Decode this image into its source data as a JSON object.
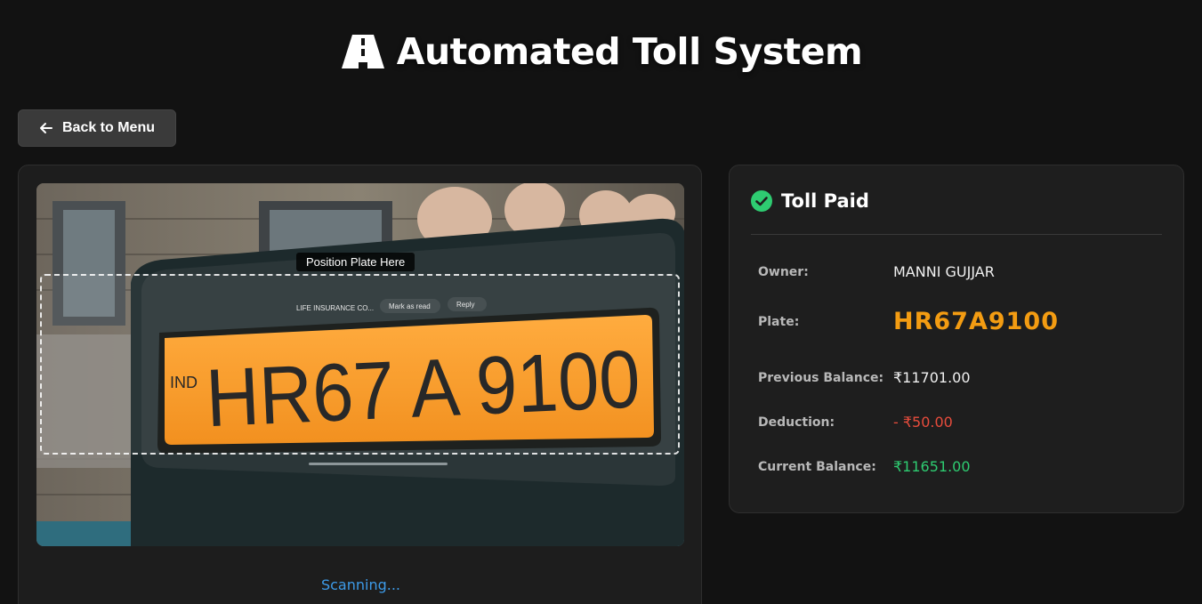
{
  "app": {
    "title": "Automated Toll System",
    "logo_icon": "road-icon"
  },
  "nav": {
    "back_label": "Back to Menu",
    "back_icon": "arrow-left-icon"
  },
  "scanner": {
    "overlay_label": "Position Plate Here",
    "status": "Scanning...",
    "camera_plate_text": "HR67 A 9100",
    "camera_plate_prefix": "IND",
    "camera_notification": {
      "text": "LIFE INSURANCE CO...",
      "action_1": "Mark as read",
      "action_2": "Reply"
    }
  },
  "result": {
    "title": "Toll Paid",
    "status_icon": "check-circle-icon",
    "rows": [
      {
        "label": "Owner:",
        "value": "MANNI GUJJAR"
      },
      {
        "label": "Plate:",
        "value": "HR67A9100"
      },
      {
        "label": "Previous Balance:",
        "value": "₹11701.00"
      },
      {
        "label": "Deduction:",
        "value": "- ₹50.00"
      },
      {
        "label": "Current Balance:",
        "value": "₹11651.00"
      }
    ]
  },
  "colors": {
    "accent_blue": "#3d9be9",
    "success_green": "#2ecc71",
    "plate_orange": "#f39c12",
    "deduction_red": "#e74c3c"
  }
}
